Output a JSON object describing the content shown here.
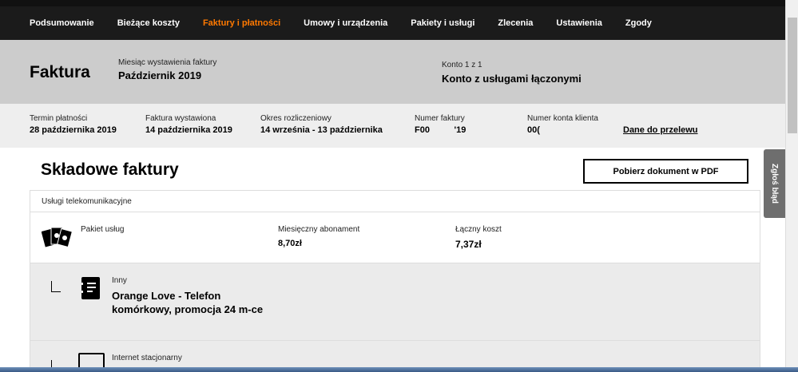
{
  "nav": {
    "items": [
      "Podsumowanie",
      "Bieżące koszty",
      "Faktury i płatności",
      "Umowy i urządzenia",
      "Pakiety i usługi",
      "Zlecenia",
      "Ustawienia",
      "Zgody"
    ],
    "active": 2
  },
  "header": {
    "title": "Faktura",
    "month_label": "Miesiąc wystawienia faktury",
    "month_value": "Październik 2019",
    "account_label": "Konto 1 z 1",
    "account_value": "Konto z usługami łączonymi"
  },
  "info": {
    "due_label": "Termin płatności",
    "due_value": "28 października 2019",
    "issued_label": "Faktura wystawiona",
    "issued_value": "14 października 2019",
    "period_label": "Okres rozliczeniowy",
    "period_value": "14 września - 13 października",
    "invoice_no_label": "Numer faktury",
    "invoice_no_value": "F00          '19",
    "client_no_label": "Numer konta klienta",
    "client_no_value": "00(",
    "transfer_link": "Dane do przelewu"
  },
  "section": {
    "title": "Składowe faktury",
    "pdf_button": "Pobierz dokument w PDF",
    "group": "Usługi telekomunikacyjne"
  },
  "package": {
    "name": "Pakiet usług",
    "monthly_label": "Miesięczny abonament",
    "monthly_value": "8,70zł",
    "total_label": "Łączny koszt",
    "total_value": "7,37zł"
  },
  "items": [
    {
      "category": "Inny",
      "name": "Orange Love - Telefon komórkowy, promocja 24 m-ce"
    },
    {
      "category": "Internet stacjonarny"
    }
  ],
  "report_button": "Zgłoś błąd",
  "colors": {
    "accent": "#ff7900",
    "nav": "#1b1b1b"
  }
}
